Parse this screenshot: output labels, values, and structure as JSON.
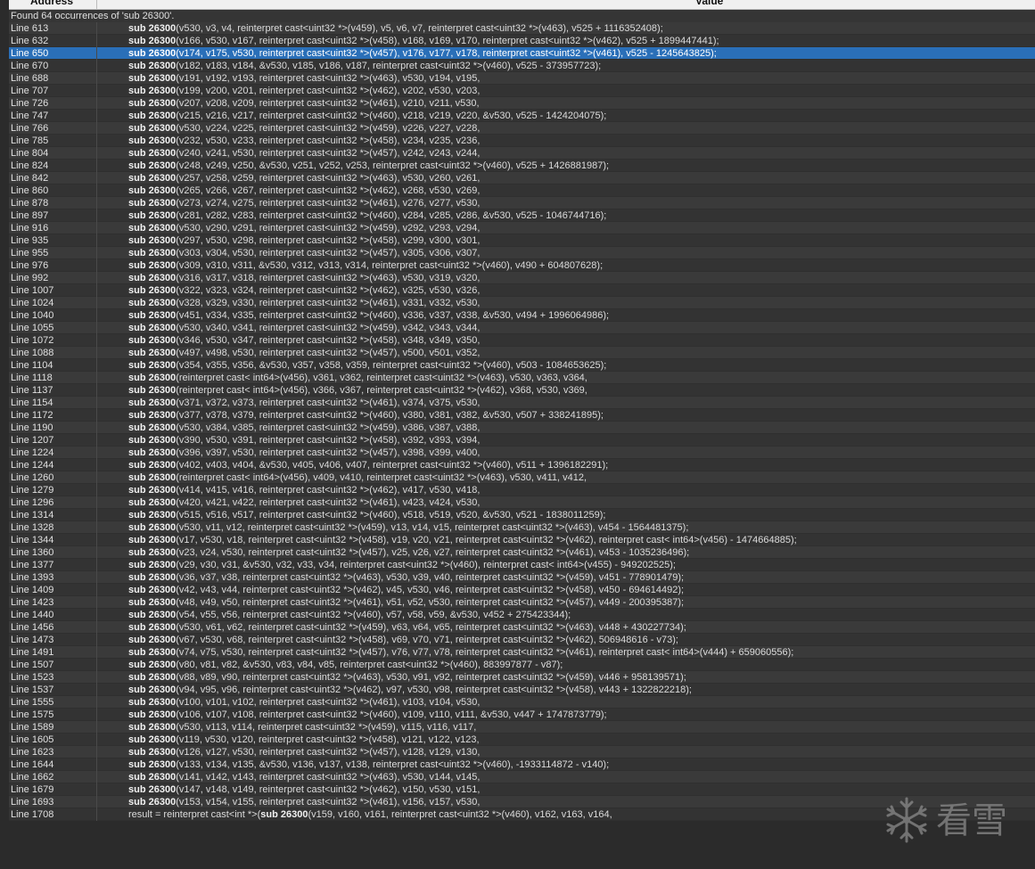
{
  "header": {
    "address_label": "Address",
    "value_label": "Value"
  },
  "summary": "Found 64 occurrences of 'sub 26300'.",
  "rows": [
    {
      "address": "Line 613",
      "pre": "",
      "func": "sub 26300",
      "args": "(v530, v3, v4, reinterpret cast<uint32 *>(v459), v5, v6, v7, reinterpret cast<uint32 *>(v463), v525 + 1116352408);"
    },
    {
      "address": "Line 632",
      "pre": "",
      "func": "sub 26300",
      "args": "(v166, v530, v167, reinterpret cast<uint32 *>(v458), v168, v169, v170, reinterpret cast<uint32 *>(v462), v525 + 1899447441);"
    },
    {
      "address": "Line 650",
      "pre": "",
      "func": "sub 26300",
      "args": "(v174, v175, v530, reinterpret cast<uint32 *>(v457), v176, v177, v178, reinterpret cast<uint32 *>(v461), v525 - 1245643825);",
      "selected": true
    },
    {
      "address": "Line 670",
      "pre": "",
      "func": "sub 26300",
      "args": "(v182, v183, v184, &v530, v185, v186, v187, reinterpret cast<uint32 *>(v460), v525 - 373957723);"
    },
    {
      "address": "Line 688",
      "pre": "",
      "func": "sub 26300",
      "args": "(v191, v192, v193, reinterpret cast<uint32 *>(v463), v530, v194, v195,"
    },
    {
      "address": "Line 707",
      "pre": "",
      "func": "sub 26300",
      "args": "(v199, v200, v201, reinterpret cast<uint32 *>(v462), v202, v530, v203,"
    },
    {
      "address": "Line 726",
      "pre": "",
      "func": "sub 26300",
      "args": "(v207, v208, v209, reinterpret cast<uint32 *>(v461), v210, v211, v530,"
    },
    {
      "address": "Line 747",
      "pre": "",
      "func": "sub 26300",
      "args": "(v215, v216, v217, reinterpret cast<uint32 *>(v460), v218, v219, v220, &v530, v525 - 1424204075);"
    },
    {
      "address": "Line 766",
      "pre": "",
      "func": "sub 26300",
      "args": "(v530, v224, v225, reinterpret cast<uint32 *>(v459), v226, v227, v228,"
    },
    {
      "address": "Line 785",
      "pre": "",
      "func": "sub 26300",
      "args": "(v232, v530, v233, reinterpret cast<uint32 *>(v458), v234, v235, v236,"
    },
    {
      "address": "Line 804",
      "pre": "",
      "func": "sub 26300",
      "args": "(v240, v241, v530, reinterpret cast<uint32 *>(v457), v242, v243, v244,"
    },
    {
      "address": "Line 824",
      "pre": "",
      "func": "sub 26300",
      "args": "(v248, v249, v250, &v530, v251, v252, v253, reinterpret cast<uint32 *>(v460), v525 + 1426881987);"
    },
    {
      "address": "Line 842",
      "pre": "",
      "func": "sub 26300",
      "args": "(v257, v258, v259, reinterpret cast<uint32 *>(v463), v530, v260, v261,"
    },
    {
      "address": "Line 860",
      "pre": "",
      "func": "sub 26300",
      "args": "(v265, v266, v267, reinterpret cast<uint32 *>(v462), v268, v530, v269,"
    },
    {
      "address": "Line 878",
      "pre": "",
      "func": "sub 26300",
      "args": "(v273, v274, v275, reinterpret cast<uint32 *>(v461), v276, v277, v530,"
    },
    {
      "address": "Line 897",
      "pre": "",
      "func": "sub 26300",
      "args": "(v281, v282, v283, reinterpret cast<uint32 *>(v460), v284, v285, v286, &v530, v525 - 1046744716);"
    },
    {
      "address": "Line 916",
      "pre": "",
      "func": "sub 26300",
      "args": "(v530, v290, v291, reinterpret cast<uint32 *>(v459), v292, v293, v294,"
    },
    {
      "address": "Line 935",
      "pre": "",
      "func": "sub 26300",
      "args": "(v297, v530, v298, reinterpret cast<uint32 *>(v458), v299, v300, v301,"
    },
    {
      "address": "Line 955",
      "pre": "",
      "func": "sub 26300",
      "args": "(v303, v304, v530, reinterpret cast<uint32 *>(v457), v305, v306, v307,"
    },
    {
      "address": "Line 976",
      "pre": "",
      "func": "sub 26300",
      "args": "(v309, v310, v311, &v530, v312, v313, v314, reinterpret cast<uint32 *>(v460), v490 + 604807628);"
    },
    {
      "address": "Line 992",
      "pre": "",
      "func": "sub 26300",
      "args": "(v316, v317, v318, reinterpret cast<uint32 *>(v463), v530, v319, v320,"
    },
    {
      "address": "Line 1007",
      "pre": "",
      "func": "sub 26300",
      "args": "(v322, v323, v324, reinterpret cast<uint32 *>(v462), v325, v530, v326,"
    },
    {
      "address": "Line 1024",
      "pre": "",
      "func": "sub 26300",
      "args": "(v328, v329, v330, reinterpret cast<uint32 *>(v461), v331, v332, v530,"
    },
    {
      "address": "Line 1040",
      "pre": "",
      "func": "sub 26300",
      "args": "(v451, v334, v335, reinterpret cast<uint32 *>(v460), v336, v337, v338, &v530, v494 + 1996064986);"
    },
    {
      "address": "Line 1055",
      "pre": "",
      "func": "sub 26300",
      "args": "(v530, v340, v341, reinterpret cast<uint32 *>(v459), v342, v343, v344,"
    },
    {
      "address": "Line 1072",
      "pre": "",
      "func": "sub 26300",
      "args": "(v346, v530, v347, reinterpret cast<uint32 *>(v458), v348, v349, v350,"
    },
    {
      "address": "Line 1088",
      "pre": "",
      "func": "sub 26300",
      "args": "(v497, v498, v530, reinterpret cast<uint32 *>(v457), v500, v501, v352,"
    },
    {
      "address": "Line 1104",
      "pre": "",
      "func": "sub 26300",
      "args": "(v354, v355, v356, &v530, v357, v358, v359, reinterpret cast<uint32 *>(v460), v503 - 1084653625);"
    },
    {
      "address": "Line 1118",
      "pre": "",
      "func": "sub 26300",
      "args": "(reinterpret cast<   int64>(v456), v361, v362, reinterpret cast<uint32 *>(v463), v530, v363, v364,"
    },
    {
      "address": "Line 1137",
      "pre": "",
      "func": "sub 26300",
      "args": "(reinterpret cast<   int64>(v456), v366, v367, reinterpret cast<uint32 *>(v462), v368, v530, v369,"
    },
    {
      "address": "Line 1154",
      "pre": "",
      "func": "sub 26300",
      "args": "(v371, v372, v373, reinterpret cast<uint32 *>(v461), v374, v375, v530,"
    },
    {
      "address": "Line 1172",
      "pre": "",
      "func": "sub 26300",
      "args": "(v377, v378, v379, reinterpret cast<uint32 *>(v460), v380, v381, v382, &v530, v507 + 338241895);"
    },
    {
      "address": "Line 1190",
      "pre": "",
      "func": "sub 26300",
      "args": "(v530, v384, v385, reinterpret cast<uint32 *>(v459), v386, v387, v388,"
    },
    {
      "address": "Line 1207",
      "pre": "",
      "func": "sub 26300",
      "args": "(v390, v530, v391, reinterpret cast<uint32 *>(v458), v392, v393, v394,"
    },
    {
      "address": "Line 1224",
      "pre": "",
      "func": "sub 26300",
      "args": "(v396, v397, v530, reinterpret cast<uint32 *>(v457), v398, v399, v400,"
    },
    {
      "address": "Line 1244",
      "pre": "",
      "func": "sub 26300",
      "args": "(v402, v403, v404, &v530, v405, v406, v407, reinterpret cast<uint32 *>(v460), v511 + 1396182291);"
    },
    {
      "address": "Line 1260",
      "pre": "",
      "func": "sub 26300",
      "args": "(reinterpret cast<   int64>(v456), v409, v410, reinterpret cast<uint32 *>(v463), v530, v411, v412,"
    },
    {
      "address": "Line 1279",
      "pre": "",
      "func": "sub 26300",
      "args": "(v414, v415, v416, reinterpret cast<uint32 *>(v462), v417, v530, v418,"
    },
    {
      "address": "Line 1296",
      "pre": "",
      "func": "sub 26300",
      "args": "(v420, v421, v422, reinterpret cast<uint32 *>(v461), v423, v424, v530,"
    },
    {
      "address": "Line 1314",
      "pre": "",
      "func": "sub 26300",
      "args": "(v515, v516, v517, reinterpret cast<uint32 *>(v460), v518, v519, v520, &v530, v521 - 1838011259);"
    },
    {
      "address": "Line 1328",
      "pre": "",
      "func": "sub 26300",
      "args": "(v530, v11, v12, reinterpret cast<uint32 *>(v459), v13, v14, v15, reinterpret cast<uint32 *>(v463), v454 - 1564481375);"
    },
    {
      "address": "Line 1344",
      "pre": "",
      "func": "sub 26300",
      "args": "(v17, v530, v18, reinterpret cast<uint32 *>(v458), v19, v20, v21, reinterpret cast<uint32 *>(v462), reinterpret cast<   int64>(v456) - 1474664885);"
    },
    {
      "address": "Line 1360",
      "pre": "",
      "func": "sub 26300",
      "args": "(v23, v24, v530, reinterpret cast<uint32 *>(v457), v25, v26, v27, reinterpret cast<uint32 *>(v461), v453 - 1035236496);"
    },
    {
      "address": "Line 1377",
      "pre": "",
      "func": "sub 26300",
      "args": "(v29, v30, v31, &v530, v32, v33, v34, reinterpret cast<uint32 *>(v460), reinterpret cast<   int64>(v455) - 949202525);"
    },
    {
      "address": "Line 1393",
      "pre": "",
      "func": "sub 26300",
      "args": "(v36, v37, v38, reinterpret cast<uint32 *>(v463), v530, v39, v40, reinterpret cast<uint32 *>(v459), v451 - 778901479);"
    },
    {
      "address": "Line 1409",
      "pre": "",
      "func": "sub 26300",
      "args": "(v42, v43, v44, reinterpret cast<uint32 *>(v462), v45, v530, v46, reinterpret cast<uint32 *>(v458), v450 - 694614492);"
    },
    {
      "address": "Line 1423",
      "pre": "",
      "func": "sub 26300",
      "args": "(v48, v49, v50, reinterpret cast<uint32 *>(v461), v51, v52, v530, reinterpret cast<uint32 *>(v457), v449 - 200395387);"
    },
    {
      "address": "Line 1440",
      "pre": "",
      "func": "sub 26300",
      "args": "(v54, v55, v56, reinterpret cast<uint32 *>(v460), v57, v58, v59, &v530, v452 + 275423344);"
    },
    {
      "address": "Line 1456",
      "pre": "",
      "func": "sub 26300",
      "args": "(v530, v61, v62, reinterpret cast<uint32 *>(v459), v63, v64, v65, reinterpret cast<uint32 *>(v463), v448 + 430227734);"
    },
    {
      "address": "Line 1473",
      "pre": "",
      "func": "sub 26300",
      "args": "(v67, v530, v68, reinterpret cast<uint32 *>(v458), v69, v70, v71, reinterpret cast<uint32 *>(v462), 506948616 - v73);"
    },
    {
      "address": "Line 1491",
      "pre": "",
      "func": "sub 26300",
      "args": "(v74, v75, v530, reinterpret cast<uint32 *>(v457), v76, v77, v78, reinterpret cast<uint32 *>(v461), reinterpret cast<   int64>(v444) + 659060556);"
    },
    {
      "address": "Line 1507",
      "pre": "",
      "func": "sub 26300",
      "args": "(v80, v81, v82, &v530, v83, v84, v85, reinterpret cast<uint32 *>(v460), 883997877 - v87);"
    },
    {
      "address": "Line 1523",
      "pre": "",
      "func": "sub 26300",
      "args": "(v88, v89, v90, reinterpret cast<uint32 *>(v463), v530, v91, v92, reinterpret cast<uint32 *>(v459), v446 + 958139571);"
    },
    {
      "address": "Line 1537",
      "pre": "",
      "func": "sub 26300",
      "args": "(v94, v95, v96, reinterpret cast<uint32 *>(v462), v97, v530, v98, reinterpret cast<uint32 *>(v458), v443 + 1322822218);"
    },
    {
      "address": "Line 1555",
      "pre": "",
      "func": "sub 26300",
      "args": "(v100, v101, v102, reinterpret cast<uint32 *>(v461), v103, v104, v530,"
    },
    {
      "address": "Line 1575",
      "pre": "",
      "func": "sub 26300",
      "args": "(v106, v107, v108, reinterpret cast<uint32 *>(v460), v109, v110, v111, &v530, v447 + 1747873779);"
    },
    {
      "address": "Line 1589",
      "pre": "",
      "func": "sub 26300",
      "args": "(v530, v113, v114, reinterpret cast<uint32 *>(v459), v115, v116, v117,"
    },
    {
      "address": "Line 1605",
      "pre": "",
      "func": "sub 26300",
      "args": "(v119, v530, v120, reinterpret cast<uint32 *>(v458), v121, v122, v123,"
    },
    {
      "address": "Line 1623",
      "pre": "",
      "func": "sub 26300",
      "args": "(v126, v127, v530, reinterpret cast<uint32 *>(v457), v128, v129, v130,"
    },
    {
      "address": "Line 1644",
      "pre": "",
      "func": "sub 26300",
      "args": "(v133, v134, v135, &v530, v136, v137, v138, reinterpret cast<uint32 *>(v460), -1933114872 - v140);"
    },
    {
      "address": "Line 1662",
      "pre": "",
      "func": "sub 26300",
      "args": "(v141, v142, v143, reinterpret cast<uint32 *>(v463), v530, v144, v145,"
    },
    {
      "address": "Line 1679",
      "pre": "",
      "func": "sub 26300",
      "args": "(v147, v148, v149, reinterpret cast<uint32 *>(v462), v150, v530, v151,"
    },
    {
      "address": "Line 1693",
      "pre": "",
      "func": "sub 26300",
      "args": "(v153, v154, v155, reinterpret cast<uint32 *>(v461), v156, v157, v530,"
    },
    {
      "address": "Line 1708",
      "pre": "result = reinterpret cast<int *>(",
      "func": "sub 26300",
      "args": "(v159, v160, v161, reinterpret cast<uint32 *>(v460), v162, v163, v164,"
    }
  ],
  "watermark": {
    "text": "看雪",
    "icon": "snowflake-icon"
  }
}
